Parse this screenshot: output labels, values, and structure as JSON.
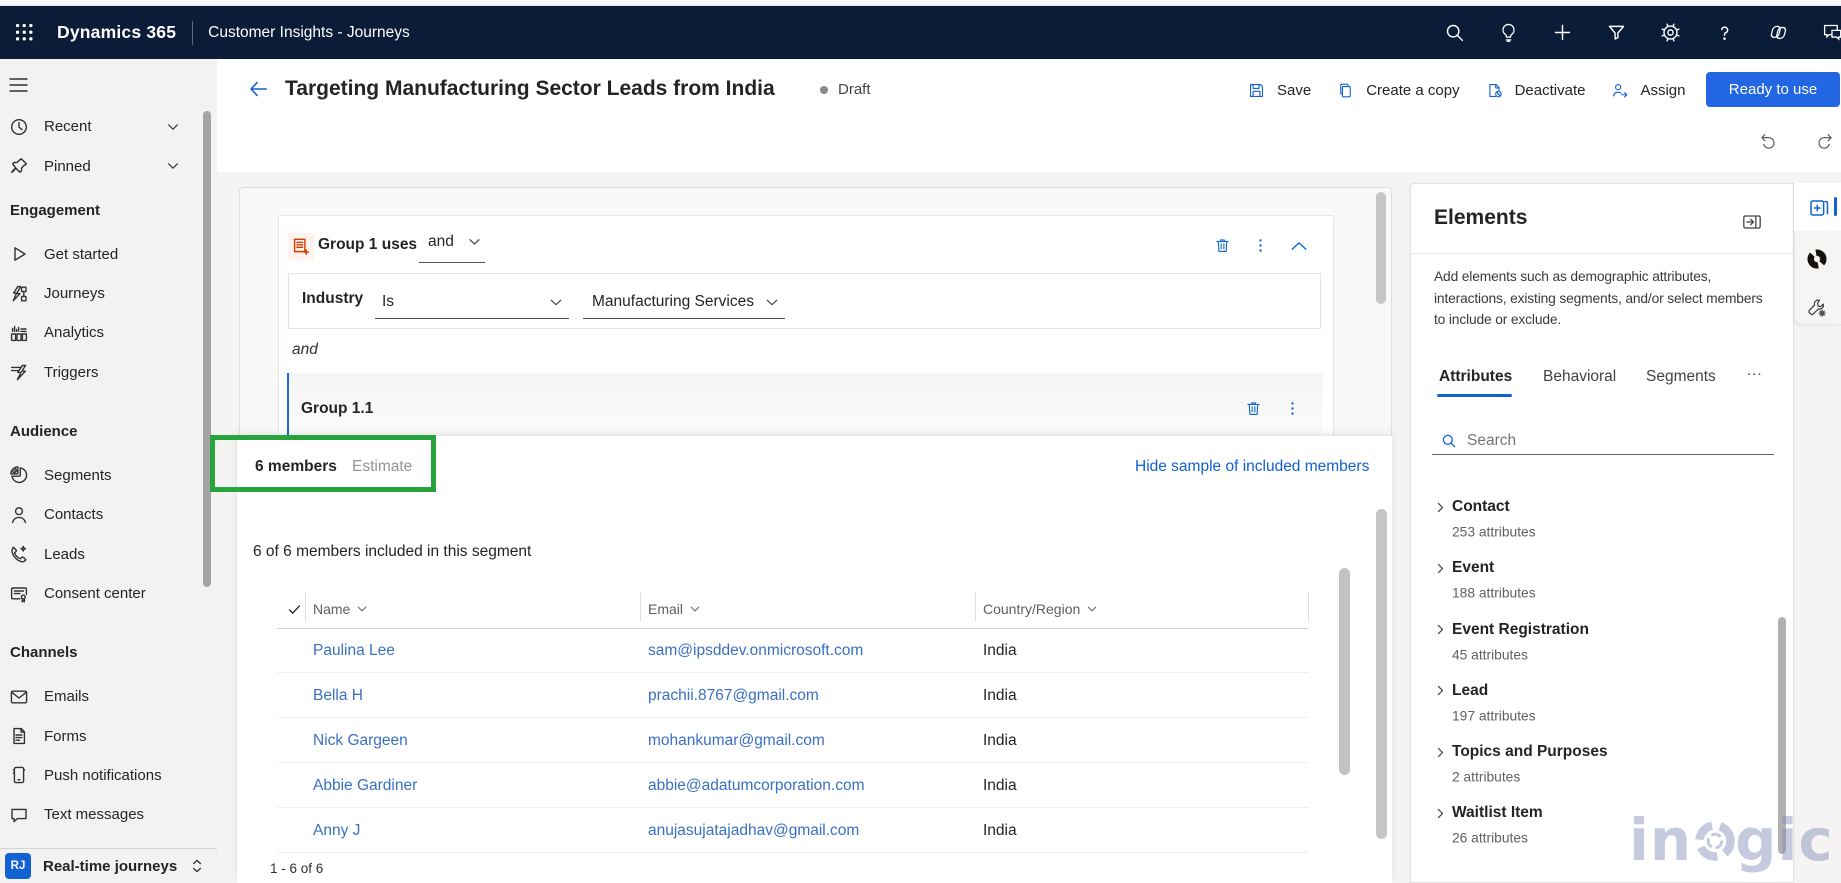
{
  "topbar": {
    "brand": "Dynamics 365",
    "app_name": "Customer Insights - Journeys",
    "icons": [
      "search-icon",
      "lightbulb-icon",
      "plus-icon",
      "filter-icon",
      "gear-icon",
      "help-icon",
      "copilot-icon",
      "feedback-icon"
    ]
  },
  "sidebar": {
    "sections": [
      {
        "header": "",
        "items": [
          {
            "icon": "clock-icon",
            "label": "Recent",
            "chevron": true
          },
          {
            "icon": "pin-icon",
            "label": "Pinned",
            "chevron": true
          }
        ]
      },
      {
        "header": "Engagement",
        "items": [
          {
            "icon": "play-icon",
            "label": "Get started"
          },
          {
            "icon": "journeys-icon",
            "label": "Journeys"
          },
          {
            "icon": "analytics-icon",
            "label": "Analytics"
          },
          {
            "icon": "triggers-icon",
            "label": "Triggers"
          }
        ]
      },
      {
        "header": "Audience",
        "items": [
          {
            "icon": "segments-icon",
            "label": "Segments"
          },
          {
            "icon": "person-icon",
            "label": "Contacts"
          },
          {
            "icon": "leads-icon",
            "label": "Leads"
          },
          {
            "icon": "consent-icon",
            "label": "Consent center"
          }
        ]
      },
      {
        "header": "Channels",
        "items": [
          {
            "icon": "mail-icon",
            "label": "Emails"
          },
          {
            "icon": "form-icon",
            "label": "Forms"
          },
          {
            "icon": "push-icon",
            "label": "Push notifications"
          },
          {
            "icon": "sms-icon",
            "label": "Text messages"
          }
        ]
      }
    ],
    "area_badge": "RJ",
    "area_label": "Real-time journeys"
  },
  "header": {
    "title": "Targeting Manufacturing Sector Leads from India",
    "status": "Draft",
    "commands": [
      {
        "icon": "save-icon",
        "label": "Save"
      },
      {
        "icon": "copy-icon",
        "label": "Create a copy"
      },
      {
        "icon": "deactivate-icon",
        "label": "Deactivate"
      },
      {
        "icon": "assign-icon",
        "label": "Assign"
      }
    ],
    "primary_button": "Ready to use"
  },
  "builder": {
    "group_title": "Group 1 uses",
    "group_operator": "and",
    "condition": {
      "attribute": "Industry",
      "operator": "Is",
      "value": "Manufacturing Services"
    },
    "connector": "and",
    "subgroup_title": "Group 1.1"
  },
  "members": {
    "tab_members": "6 members",
    "tab_estimate": "Estimate",
    "hide_link": "Hide sample of included members",
    "caption": "6 of 6 members included in this segment",
    "columns": [
      "Name",
      "Email",
      "Country/Region"
    ],
    "rows": [
      {
        "name": "Paulina Lee",
        "email": "sam@ipsddev.onmicrosoft.com",
        "country": "India"
      },
      {
        "name": "Bella H",
        "email": "prachii.8767@gmail.com",
        "country": "India"
      },
      {
        "name": "Nick Gargeen",
        "email": "mohankumar@gmail.com",
        "country": "India"
      },
      {
        "name": "Abbie Gardiner",
        "email": "abbie@adatumcorporation.com",
        "country": "India"
      },
      {
        "name": "Anny J",
        "email": "anujasujatajadhav@gmail.com",
        "country": "India"
      }
    ],
    "pager": "1 - 6 of 6"
  },
  "elements_panel": {
    "title": "Elements",
    "description": "Add elements such as demographic attributes, interactions, existing segments, and/or select members to include or exclude.",
    "tabs": [
      "Attributes",
      "Behavioral",
      "Segments"
    ],
    "more_tab": "...",
    "search_placeholder": "Search",
    "groups": [
      {
        "name": "Contact",
        "attributes": "253 attributes"
      },
      {
        "name": "Event",
        "attributes": "188 attributes"
      },
      {
        "name": "Event Registration",
        "attributes": "45 attributes"
      },
      {
        "name": "Lead",
        "attributes": "197 attributes"
      },
      {
        "name": "Topics and Purposes",
        "attributes": "2 attributes"
      },
      {
        "name": "Waitlist Item",
        "attributes": "26 attributes"
      }
    ]
  },
  "watermark": "inogic",
  "colors": {
    "topbar_bg": "#0a1c38",
    "accent_blue": "#1160d4",
    "primary_button_bg": "#2266e3",
    "annotation_green": "#28a43c",
    "link_blue": "#3a70c2"
  }
}
